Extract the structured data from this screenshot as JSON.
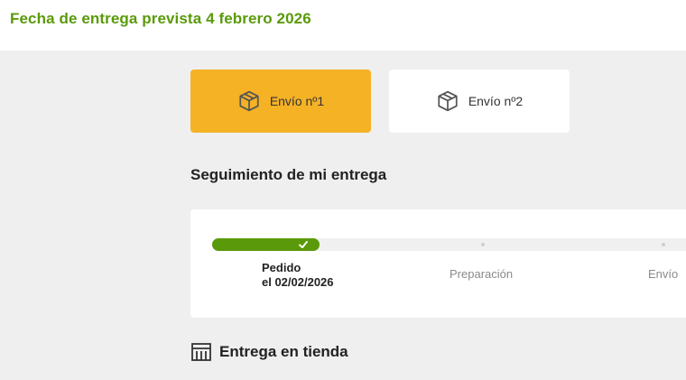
{
  "header": {
    "delivery_title": "Fecha de entrega prevista 4 febrero 2026"
  },
  "shipments": [
    {
      "label": "Envío nº1",
      "icon": "package-icon",
      "active": true
    },
    {
      "label": "Envío nº2",
      "icon": "package-icon",
      "active": false
    }
  ],
  "tracking": {
    "title": "Seguimiento de mi entrega",
    "progress": 0.22,
    "steps": [
      {
        "label": "Pedido",
        "date": "el 02/02/2026",
        "status": "done"
      },
      {
        "label": "Preparación",
        "status": "pending"
      },
      {
        "label": "Envío",
        "status": "pending"
      }
    ]
  },
  "store": {
    "title": "Entrega en tienda",
    "icon": "store-icon"
  },
  "colors": {
    "accent_green": "#5a9a0a",
    "active_tab": "#f5b225",
    "background": "#efefef"
  }
}
